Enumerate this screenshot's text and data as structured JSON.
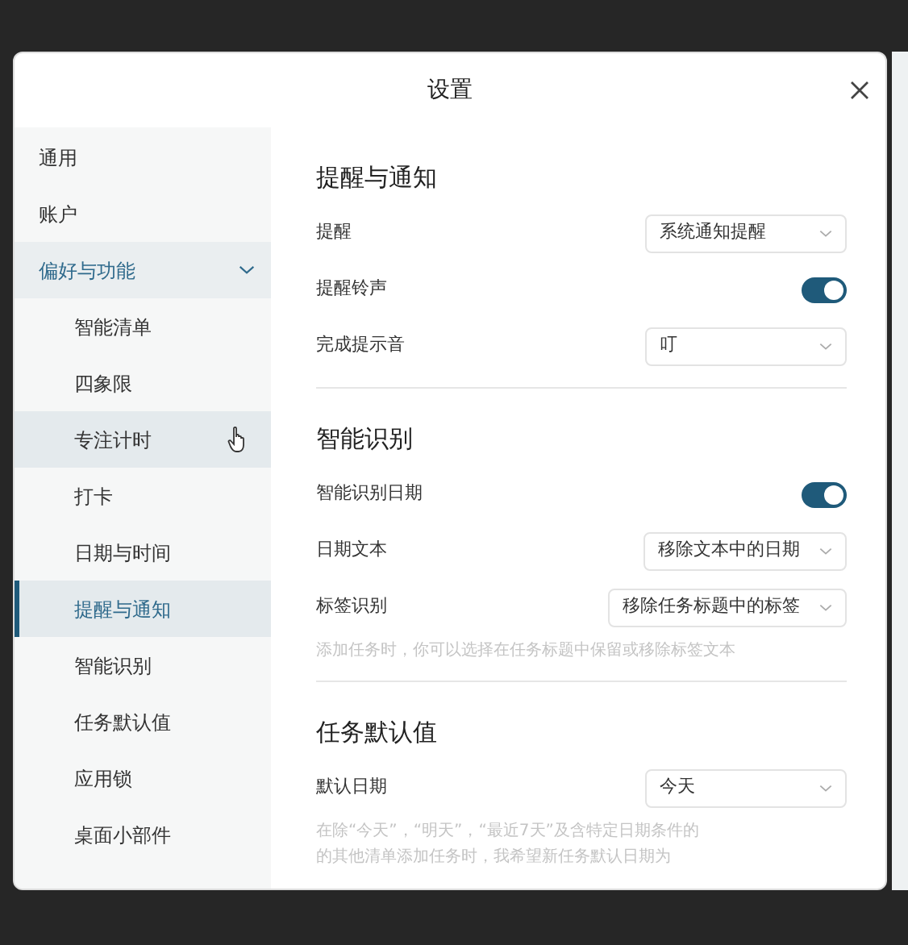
{
  "dialog": {
    "title": "设置"
  },
  "sidebar": {
    "items": [
      {
        "label": "通用",
        "selected": false,
        "hovered": false
      },
      {
        "label": "账户",
        "selected": false,
        "hovered": false
      },
      {
        "label": "偏好与功能",
        "selected": false,
        "hovered": false,
        "expanded": true,
        "children": [
          {
            "label": "智能清单",
            "selected": false,
            "hovered": false
          },
          {
            "label": "四象限",
            "selected": false,
            "hovered": false
          },
          {
            "label": "专注计时",
            "selected": false,
            "hovered": true
          },
          {
            "label": "打卡",
            "selected": false,
            "hovered": false
          },
          {
            "label": "日期与时间",
            "selected": false,
            "hovered": false
          },
          {
            "label": "提醒与通知",
            "selected": true,
            "hovered": false
          },
          {
            "label": "智能识别",
            "selected": false,
            "hovered": false
          },
          {
            "label": "任务默认值",
            "selected": false,
            "hovered": false
          },
          {
            "label": "应用锁",
            "selected": false,
            "hovered": false
          },
          {
            "label": "桌面小部件",
            "selected": false,
            "hovered": false
          }
        ]
      }
    ]
  },
  "sections": [
    {
      "title": "提醒与通知",
      "rows": [
        {
          "kind": "select",
          "label": "提醒",
          "value": "系统通知提醒"
        },
        {
          "kind": "toggle",
          "label": "提醒铃声",
          "on": true
        },
        {
          "kind": "select",
          "label": "完成提示音",
          "value": "叮"
        }
      ]
    },
    {
      "title": "智能识别",
      "rows": [
        {
          "kind": "toggle",
          "label": "智能识别日期",
          "on": true
        },
        {
          "kind": "select",
          "label": "日期文本",
          "value": "移除文本中的日期"
        },
        {
          "kind": "select",
          "label": "标签识别",
          "value": "移除任务标题中的标签"
        },
        {
          "kind": "hint",
          "lines": [
            "添加任务时，你可以选择在任务标题中保留或移除标签文本"
          ]
        }
      ]
    },
    {
      "title": "任务默认值",
      "rows": [
        {
          "kind": "select",
          "label": "默认日期",
          "value": "今天"
        },
        {
          "kind": "hint",
          "lines": [
            "在除“今天”，“明天”，“最近7天”及含特定日期条件的",
            "的其他清单添加任务时，我希望新任务默认日期为"
          ]
        }
      ]
    }
  ]
}
